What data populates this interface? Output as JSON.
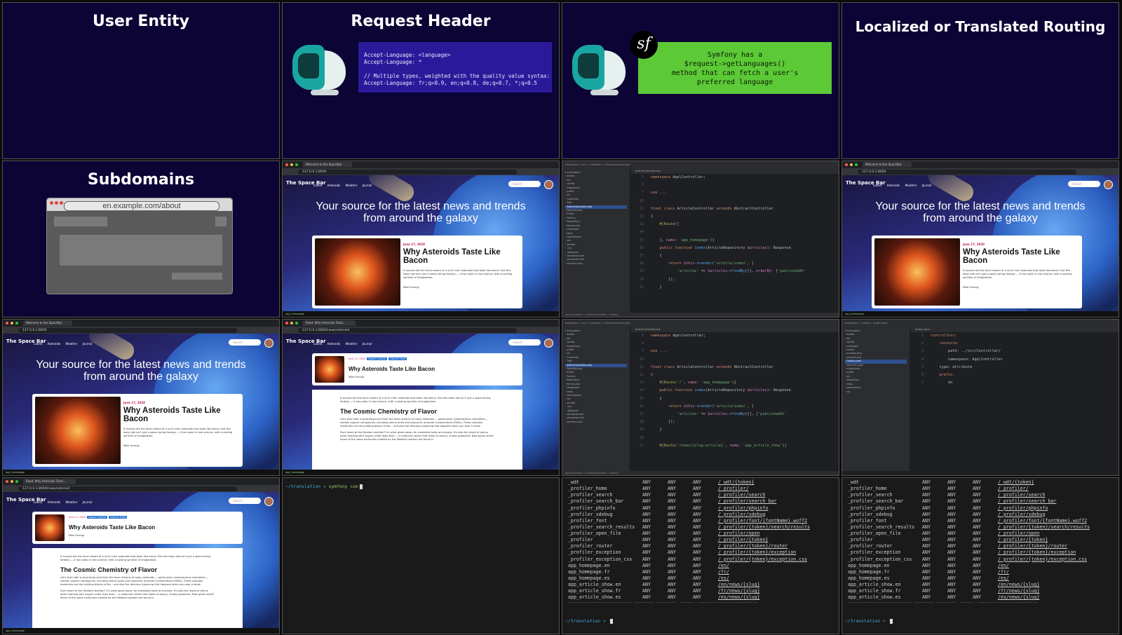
{
  "slides": {
    "user_entity": "User Entity",
    "request_header": "Request Header",
    "localized_routing": "Localized or Translated Routing",
    "subdomains": "Subdomains",
    "subdomain_url": "en.example.com/about",
    "sf_badge": "sf"
  },
  "request_header_code": "Accept-Language: <language>\nAccept-Language: *\n\n// Multiple types, weighted with the quality value syntax:\nAccept-Language: fr;q=0.9, en;q=0.8, de;q=0.7, *;q=0.5",
  "symfony_note": "Symfony has a\n$request->getLanguages()\nmethod that can fetch a user's\npreferred language",
  "browser": {
    "tab_title": "Welcome to the SpaceBar",
    "tab_title_article": "Read: Why Asteroids Taste...",
    "url_home": "127.0.0.1:8000",
    "url_article": "127.0.0.1:8000/news/asteroid",
    "brand": "The Space Bar",
    "nav": "Latest Asteroids Weather Journal",
    "search_placeholder": "Search",
    "tagline": "Your source for the latest news and trends from around the galaxy",
    "card_date": "June 17, 2020",
    "card_title": "Why Asteroids Taste Like Bacon",
    "card_excerpt": "It sounds like the fever dream of a sci-fi chef: asteroids that taste like bacon. But this tasty tale isn't just a space-faring fantasy — it has roots in real science, with a sizzling sprinkle of imagination.",
    "card_author": "Mike Ferengi",
    "tags": [
      "Space Cuisine",
      "Cosmic Food"
    ],
    "article_intro": "It sounds like the fever dream of a sci-fi chef: asteroids that taste like bacon. But this tasty tale isn't just a space-faring fantasy — it has roots in real science, with a sizzling sprinkle of imagination.",
    "article_heading": "The Cosmic Chemistry of Flavor",
    "article_p1": "Let's start with a surprising truth from the fever dreams of many asteroids — particularly carbonaceous chondrites — contain organic compounds, including amino acids and polycyclic aromatic hydrocarbons (PAHs). These complex molecules are the building blocks of life... and also the delicious browning that happens when you sear a steak.",
    "article_p2": "Ever heard of the Maillard reaction? It's what gives bacon its irresistible taste and aroma. It's also the result of amino acids reacting with sugars under high heat — a molecular dance that leads to savory, smoky goodness. Now guess what? Some of the same molecules created by the Maillard reaction are found in",
    "status_left": "app_homepage",
    "status_right": "Symfony 7.2"
  },
  "ide": {
    "breadcrumb": "translation > src > Controller > ArticleController.php",
    "breadcrumb_yaml": "translation > config > routes.yaml",
    "tab": "ArticleController.php",
    "tab_yaml": "routes.yaml",
    "tree_items": [
      "translation",
      "assets",
      "bin",
      "config",
      "migrations",
      "public",
      "src",
      "Controller",
      "Trait",
      "ArticleController.php",
      "DataFixtures",
      "Entity",
      "Factory",
      "Repository",
      "Kernel.php",
      "templates",
      "tests",
      "translations",
      "var",
      "vendor",
      ".env",
      ".gitignore",
      "composer.json",
      "composer.lock",
      "symfony.lock"
    ],
    "tree_items_config": [
      "translation",
      "assets",
      "bin",
      "config",
      "packages",
      "routes",
      "bundles.php",
      "preload.php",
      "routes.yaml",
      "services.yaml",
      "migrations",
      "public",
      "src",
      "templates",
      "tests",
      "translations",
      "var"
    ],
    "footer": "app\\Controller > ArticleController > index()",
    "yaml_lines": [
      "controllers:",
      "    resource:",
      "        path: ../src/Controller/",
      "        namespace: App\\Controller",
      "    type: attribute",
      "    prefix:",
      "        en"
    ]
  },
  "terminal": {
    "prompt": "~/translation",
    "cmd": "symfony con",
    "routes": [
      [
        "_wdt",
        "ANY",
        "ANY",
        "ANY",
        "/_wdt/{token}"
      ],
      [
        "_profiler_home",
        "ANY",
        "ANY",
        "ANY",
        "/_profiler/"
      ],
      [
        "_profiler_search",
        "ANY",
        "ANY",
        "ANY",
        "/_profiler/search"
      ],
      [
        "_profiler_search_bar",
        "ANY",
        "ANY",
        "ANY",
        "/_profiler/search_bar"
      ],
      [
        "_profiler_phpinfo",
        "ANY",
        "ANY",
        "ANY",
        "/_profiler/phpinfo"
      ],
      [
        "_profiler_xdebug",
        "ANY",
        "ANY",
        "ANY",
        "/_profiler/xdebug"
      ],
      [
        "_profiler_font",
        "ANY",
        "ANY",
        "ANY",
        "/_profiler/font/{fontName}.woff2"
      ],
      [
        "_profiler_search_results",
        "ANY",
        "ANY",
        "ANY",
        "/_profiler/{token}/search/results"
      ],
      [
        "_profiler_open_file",
        "ANY",
        "ANY",
        "ANY",
        "/_profiler/open"
      ],
      [
        "_profiler",
        "ANY",
        "ANY",
        "ANY",
        "/_profiler/{token}"
      ],
      [
        "_profiler_router",
        "ANY",
        "ANY",
        "ANY",
        "/_profiler/{token}/router"
      ],
      [
        "_profiler_exception",
        "ANY",
        "ANY",
        "ANY",
        "/_profiler/{token}/exception"
      ],
      [
        "_profiler_exception_css",
        "ANY",
        "ANY",
        "ANY",
        "/_profiler/{token}/exception.css"
      ],
      [
        "app_homepage.en",
        "ANY",
        "ANY",
        "ANY",
        "/en/"
      ],
      [
        "app_homepage.fr",
        "ANY",
        "ANY",
        "ANY",
        "/fr/"
      ],
      [
        "app_homepage.es",
        "ANY",
        "ANY",
        "ANY",
        "/es/"
      ],
      [
        "app_article_show.en",
        "ANY",
        "ANY",
        "ANY",
        "/en/news/{slug}"
      ],
      [
        "app_article_show.fr",
        "ANY",
        "ANY",
        "ANY",
        "/fr/news/{slug}"
      ],
      [
        "app_article_show.es",
        "ANY",
        "ANY",
        "ANY",
        "/es/news/{slug}"
      ]
    ],
    "dashes": "------------------------- -------- -------- ------ ------------------------"
  },
  "colors": {
    "slide_bg": "#0b0435",
    "code_box": "#2a1a9a",
    "green_box": "#5cc936",
    "terminal_bg": "#1a1a1a",
    "ide_bg": "#1e1f22"
  }
}
